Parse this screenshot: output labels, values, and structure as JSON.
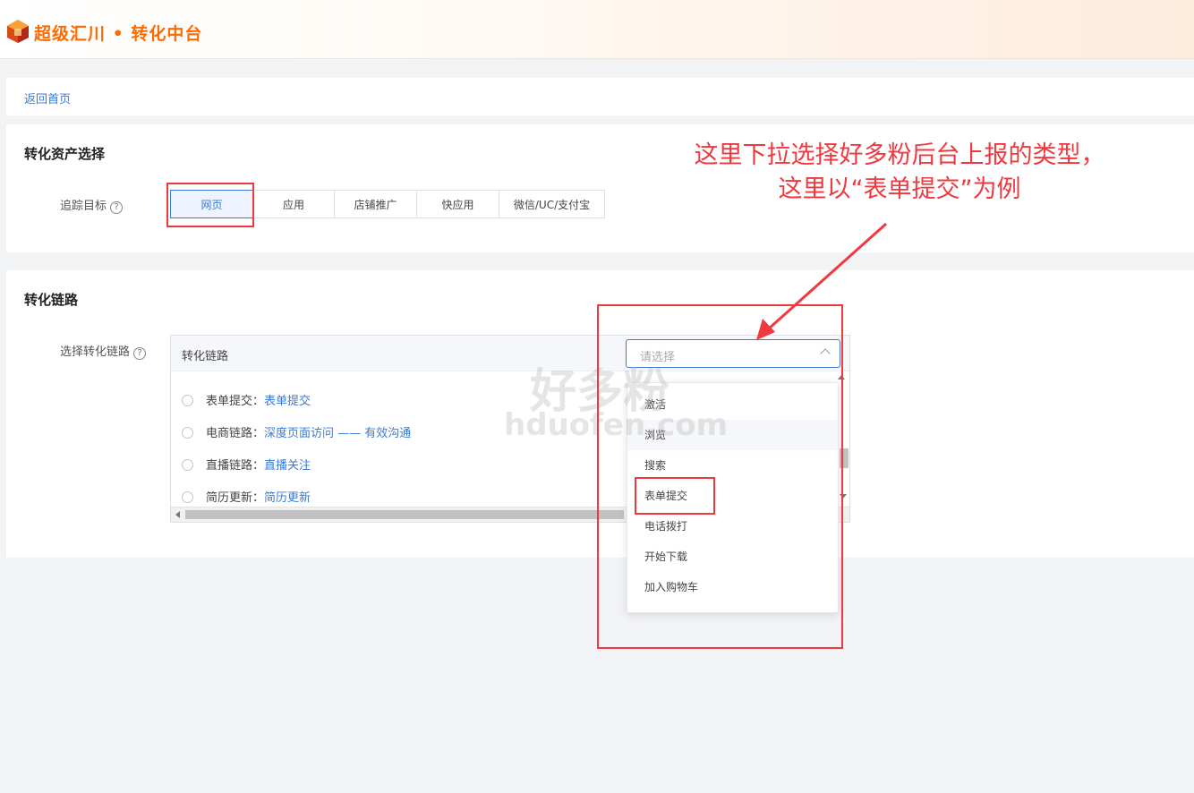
{
  "header": {
    "brand": "超级汇川 • 转化中台"
  },
  "nav": {
    "back": "返回首页"
  },
  "asset": {
    "title": "转化资产选择",
    "label": "追踪目标",
    "tabs": [
      {
        "label": "网页",
        "active": true
      },
      {
        "label": "应用",
        "active": false
      },
      {
        "label": "店铺推广",
        "active": false
      },
      {
        "label": "快应用",
        "active": false
      },
      {
        "label": "微信/UC/支付宝",
        "active": false
      }
    ]
  },
  "chain": {
    "title": "转化链路",
    "label": "选择转化链路",
    "header_label": "转化链路",
    "select_placeholder": "请选择",
    "rows": [
      {
        "label": "表单提交：",
        "value": "表单提交"
      },
      {
        "label": "电商链路：",
        "value": "深度页面访问 —— 有效沟通"
      },
      {
        "label": "直播链路：",
        "value": "直播关注"
      },
      {
        "label": "简历更新：",
        "value": "简历更新"
      }
    ],
    "dropdown_options": [
      "激活",
      "浏览",
      "搜索",
      "表单提交",
      "电话拨打",
      "开始下载",
      "加入购物车"
    ]
  },
  "annotation": {
    "line1": "这里下拉选择好多粉后台上报的类型，",
    "line2": "这里以“表单提交”为例",
    "color": "#f0383f"
  },
  "watermark": {
    "cn": "好多粉",
    "en": "hduofen.com"
  },
  "colors": {
    "brand": "#ff6a00",
    "accent": "#3a7bd5",
    "annotation": "#f0383f"
  }
}
